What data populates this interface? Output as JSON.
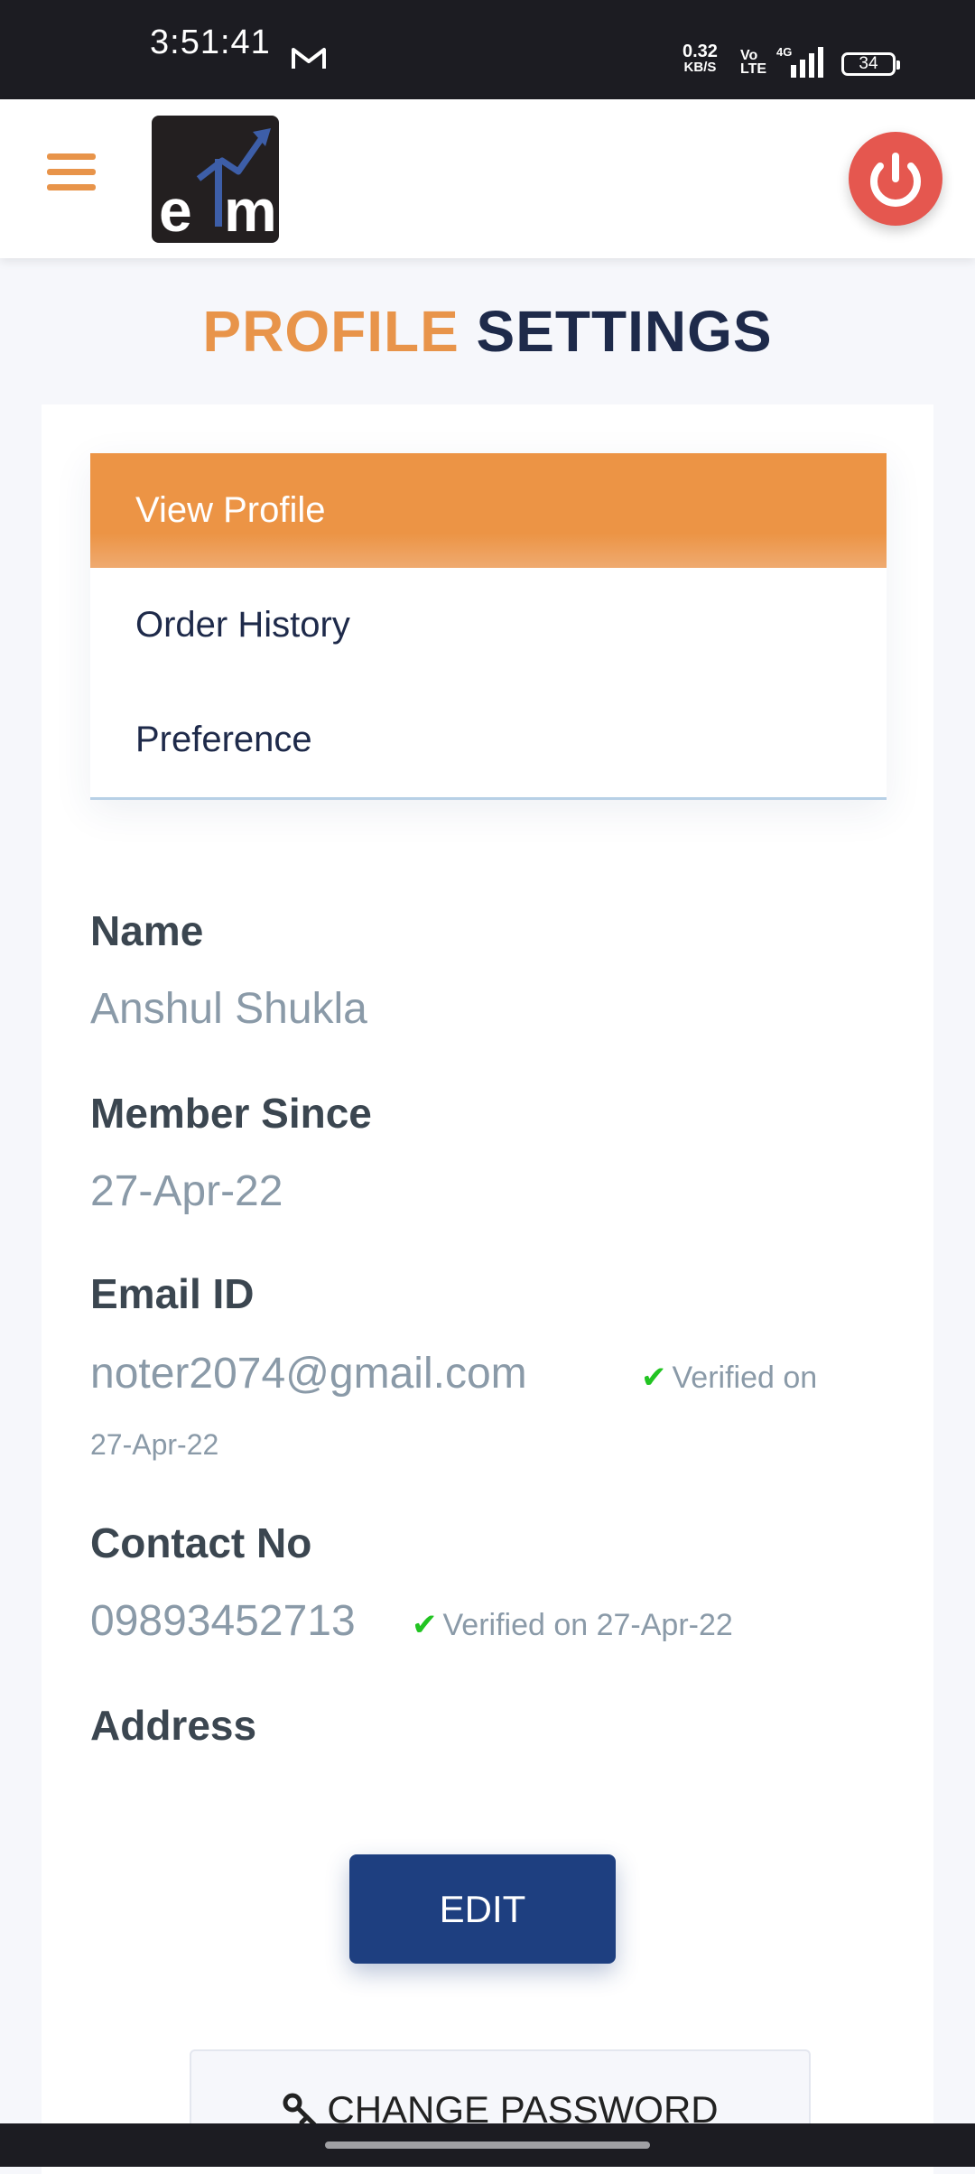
{
  "status_bar": {
    "time": "3:51:41",
    "net_speed": "0.32",
    "net_unit": "KB/S",
    "volte_top": "Vo",
    "volte_bottom": "LTE",
    "network": "4G",
    "battery": "34"
  },
  "header": {
    "logo_text": "elm",
    "menu_icon": "hamburger-icon",
    "power_icon": "power-icon"
  },
  "page_title": {
    "part1": "PROFILE",
    "part2": "SETTINGS"
  },
  "tabs": [
    {
      "label": "View Profile",
      "active": true
    },
    {
      "label": "Order History",
      "active": false
    },
    {
      "label": "Preference",
      "active": false
    }
  ],
  "profile": {
    "name_label": "Name",
    "name_value": "Anshul Shukla",
    "member_label": "Member Since",
    "member_value": "27-Apr-22",
    "email_label": "Email ID",
    "email_value": "noter2074@gmail.com",
    "email_verified": "Verified on",
    "email_verified_date": "27-Apr-22",
    "contact_label": "Contact No",
    "contact_value": "09893452713",
    "contact_verified": "Verified on 27-Apr-22",
    "address_label": "Address"
  },
  "buttons": {
    "edit": "EDIT",
    "change_password": "CHANGE PASSWORD"
  },
  "colors": {
    "accent_orange": "#ec9445",
    "navy": "#1e3f80",
    "power_red": "#e5574f",
    "verified_green": "#22c422"
  }
}
